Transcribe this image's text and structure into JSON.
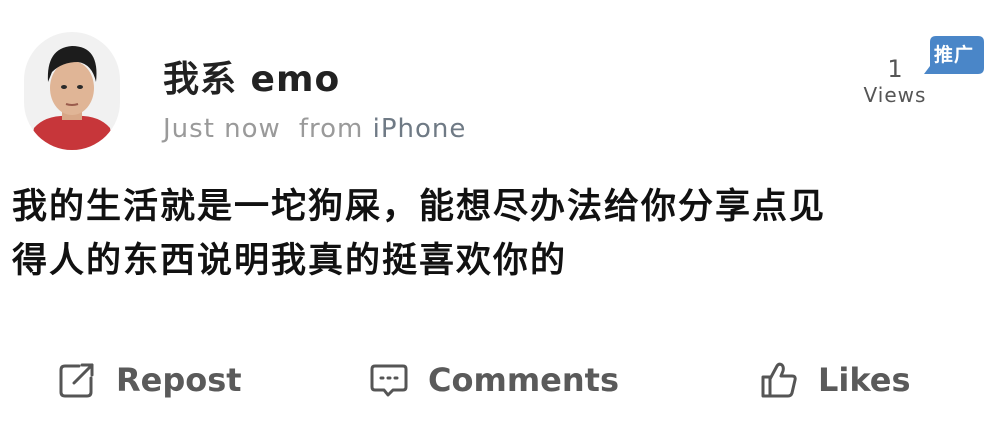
{
  "post": {
    "username": "我系 emo",
    "time": "Just now",
    "source_prefix": "from",
    "source": "iPhone",
    "ad_badge": "推广",
    "views_count": "1",
    "views_label": "Views",
    "content_lines": [
      "我的生活就是一坨狗屎，能想尽办法给你分享点见",
      "得人的东西说明我真的挺喜欢你的"
    ]
  },
  "actions": {
    "repost_label": "Repost",
    "comments_label": "Comments",
    "likes_label": "Likes"
  },
  "colors": {
    "badge": "#4a86c8",
    "source_text": "#6f7a85",
    "meta_text": "#9a9a9a",
    "action_text": "#5a5a5a"
  },
  "icons": {
    "repost": "repost-icon",
    "comments": "comment-icon",
    "likes": "thumbs-up-icon"
  }
}
